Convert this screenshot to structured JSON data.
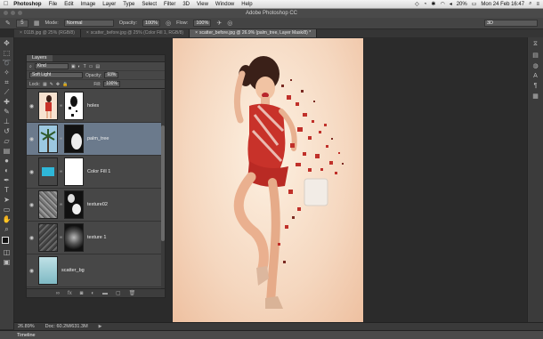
{
  "menubar": {
    "apple": "",
    "items": [
      "Photoshop",
      "File",
      "Edit",
      "Image",
      "Layer",
      "Type",
      "Select",
      "Filter",
      "3D",
      "View",
      "Window",
      "Help"
    ],
    "battery": "20%",
    "clock": "Mon 24 Feb  16:47"
  },
  "window": {
    "title": "Adobe Photoshop CC"
  },
  "options": {
    "mode_label": "Mode:",
    "mode_value": "Normal",
    "opacity_label": "Opacity:",
    "opacity_value": "100%",
    "flow_label": "Flow:",
    "flow_value": "100%",
    "brush_size": "5",
    "workspace": "3D"
  },
  "tabs": [
    {
      "label": "011B.jpg @ 25% (RGB/8)",
      "active": false
    },
    {
      "label": "scatter_before.jpg @ 25% (Color Fill 1, RGB/8)",
      "active": false
    },
    {
      "label": "scatter_before.jpg @ 26.9% (palm_tree, Layer Mask/8) *",
      "active": true
    }
  ],
  "layers_panel": {
    "tab": "Layers",
    "filter": "Kind",
    "blend_mode": "Soft Light",
    "opacity_label": "Opacity:",
    "opacity_value": "93%",
    "lock_label": "Lock:",
    "fill_label": "Fill:",
    "fill_value": "100%",
    "layers": [
      {
        "name": "holes",
        "thumb": "woman",
        "mask": "holes",
        "selected": false
      },
      {
        "name": "palm_tree",
        "thumb": "palm",
        "mask": "palm",
        "selected": true
      },
      {
        "name": "Color Fill 1",
        "thumb": "cyan",
        "mask": "white",
        "selected": false
      },
      {
        "name": "texture02",
        "thumb": "noise",
        "mask": "blobs",
        "selected": false
      },
      {
        "name": "texture 1",
        "thumb": "noise-dark",
        "mask": "glow",
        "selected": false
      },
      {
        "name": "scatter_bg",
        "thumb": "bg",
        "mask": "",
        "selected": false
      }
    ]
  },
  "status": {
    "zoom": "26.89%",
    "doc": "Doc: 60.2M/631.3M"
  },
  "timeline": {
    "label": "Timeline"
  },
  "colors": {
    "selected_layer": "#6b7a8c",
    "fill_layer": "#2fb7d8",
    "background": "#2b2b2b"
  }
}
